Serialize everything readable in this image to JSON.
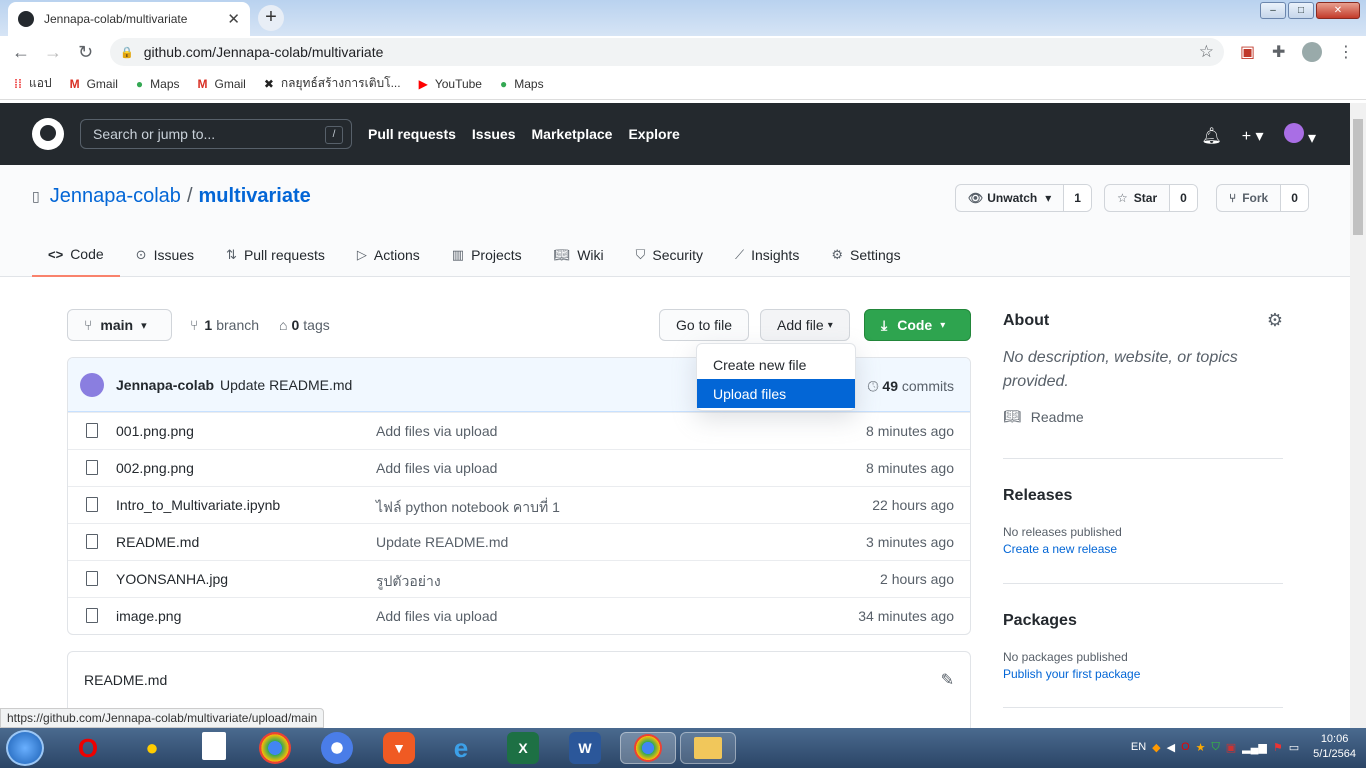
{
  "browser": {
    "tab_title": "Jennapa-colab/multivariate",
    "url": "github.com/Jennapa-colab/multivariate",
    "bookmarks": [
      "แอป",
      "Gmail",
      "Maps",
      "Gmail",
      "กลยุทธ์สร้างการเติบโ...",
      "YouTube",
      "Maps"
    ],
    "status_url": "https://github.com/Jennapa-colab/multivariate/upload/main"
  },
  "github": {
    "search_placeholder": "Search or jump to...",
    "search_key": "/",
    "nav": [
      "Pull requests",
      "Issues",
      "Marketplace",
      "Explore"
    ]
  },
  "repo": {
    "owner": "Jennapa-colab",
    "name": "multivariate",
    "watch_label": "Unwatch",
    "watch_count": "1",
    "star_label": "Star",
    "star_count": "0",
    "fork_label": "Fork",
    "fork_count": "0",
    "tabs": [
      "Code",
      "Issues",
      "Pull requests",
      "Actions",
      "Projects",
      "Wiki",
      "Security",
      "Insights",
      "Settings"
    ],
    "branch": "main",
    "branch_count": "1",
    "branch_label": "branch",
    "tag_count": "0",
    "tag_label": "tags",
    "goto_file": "Go to file",
    "add_file": "Add file",
    "code_btn": "Code",
    "dropdown": [
      "Create new file",
      "Upload files"
    ],
    "last_commit_author": "Jennapa-colab",
    "last_commit_msg": "Update README.md",
    "commit_count": "49",
    "commit_label": "commits",
    "files": [
      {
        "name": "001.png.png",
        "msg": "Add files via upload",
        "time": "8 minutes ago"
      },
      {
        "name": "002.png.png",
        "msg": "Add files via upload",
        "time": "8 minutes ago"
      },
      {
        "name": "Intro_to_Multivariate.ipynb",
        "msg": "ไฟล์ python notebook คาบที่ 1",
        "time": "22 hours ago"
      },
      {
        "name": "README.md",
        "msg": "Update README.md",
        "time": "3 minutes ago"
      },
      {
        "name": "YOONSANHA.jpg",
        "msg": "รูปตัวอย่าง",
        "time": "2 hours ago"
      },
      {
        "name": "image.png",
        "msg": "Add files via upload",
        "time": "34 minutes ago"
      }
    ],
    "readme_title": "README.md"
  },
  "sidebar": {
    "about": "About",
    "about_desc": "No description, website, or topics provided.",
    "readme": "Readme",
    "releases": "Releases",
    "no_releases": "No releases published",
    "create_release": "Create a new release",
    "packages": "Packages",
    "no_packages": "No packages published",
    "publish_package": "Publish your first package"
  },
  "taskbar": {
    "lang": "EN",
    "time": "10:06",
    "date": "5/1/2564"
  }
}
